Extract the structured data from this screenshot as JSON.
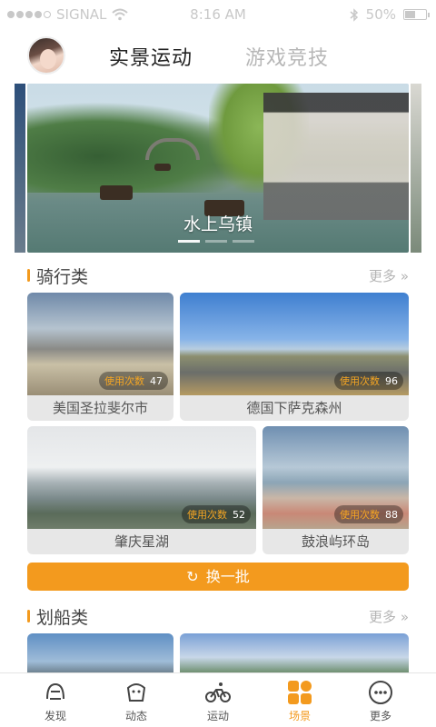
{
  "status_bar": {
    "carrier": "SIGNAL",
    "time": "8:16 AM",
    "battery": "50%",
    "battery_level": 0.5,
    "signal_dots_filled": 4
  },
  "header": {
    "tabs": [
      {
        "label": "实景运动",
        "active": true
      },
      {
        "label": "游戏竞技",
        "active": false
      }
    ]
  },
  "banner": {
    "title": "水上乌镇",
    "page_count": 3,
    "active_page": 1
  },
  "sections": {
    "cycling": {
      "title": "骑行类",
      "more_label": "更多"
    },
    "rowing": {
      "title": "划船类",
      "more_label": "更多"
    }
  },
  "usage_label": "使用次数",
  "cards": [
    {
      "name": "美国圣拉斐尔市",
      "count": "47"
    },
    {
      "name": "德国下萨克森州",
      "count": "96"
    },
    {
      "name": "肇庆星湖",
      "count": "52"
    },
    {
      "name": "鼓浪屿环岛",
      "count": "88"
    }
  ],
  "refresh_label": "换一批",
  "bottom_nav": [
    {
      "label": "发现",
      "icon": "discover-icon",
      "active": false
    },
    {
      "label": "动态",
      "icon": "activity-icon",
      "active": false
    },
    {
      "label": "运动",
      "icon": "bicycle-icon",
      "active": false
    },
    {
      "label": "场景",
      "icon": "scenes-icon",
      "active": true
    },
    {
      "label": "更多",
      "icon": "more-icon",
      "active": false
    }
  ],
  "colors": {
    "accent": "#f39a1e",
    "caption_bg": "#e7e7e7",
    "inactive_tab": "#b7b7b7"
  }
}
